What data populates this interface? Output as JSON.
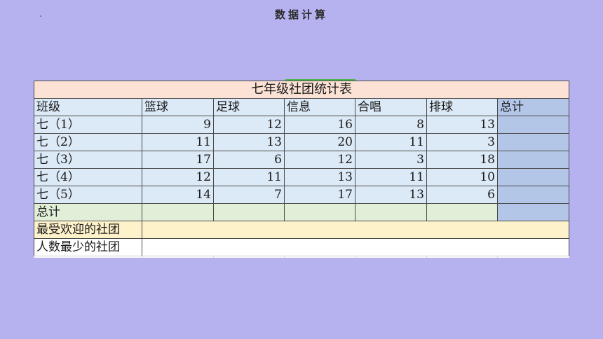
{
  "slide": {
    "title": "数据计算"
  },
  "colors": {
    "background": "#b6b2f0",
    "title_row": "#fbe2d4",
    "data_cells": "#dce9f6",
    "total_column": "#b3c6e7",
    "sum_row": "#e1efd9",
    "popular_row": "#fef2cb",
    "least_row": "#ffffff"
  },
  "table": {
    "title": "七年级社团统计表",
    "header": {
      "class_label": "班级",
      "clubs": [
        "篮球",
        "足球",
        "信息",
        "合唱",
        "排球"
      ],
      "total_label": "总计"
    },
    "rows": [
      {
        "class": "七（1）",
        "values": [
          9,
          12,
          16,
          8,
          13
        ],
        "total": ""
      },
      {
        "class": "七（2）",
        "values": [
          11,
          13,
          20,
          11,
          3
        ],
        "total": ""
      },
      {
        "class": "七（3）",
        "values": [
          17,
          6,
          12,
          3,
          18
        ],
        "total": ""
      },
      {
        "class": "七（4）",
        "values": [
          12,
          11,
          13,
          11,
          10
        ],
        "total": ""
      },
      {
        "class": "七（5）",
        "values": [
          14,
          7,
          17,
          13,
          6
        ],
        "total": ""
      }
    ],
    "sum_row": {
      "label": "总计",
      "values": [
        "",
        "",
        "",
        "",
        ""
      ],
      "total": ""
    },
    "popular_row": {
      "label": "最受欢迎的社团",
      "value": ""
    },
    "least_row": {
      "label": "人数最少的社团",
      "value": ""
    }
  }
}
